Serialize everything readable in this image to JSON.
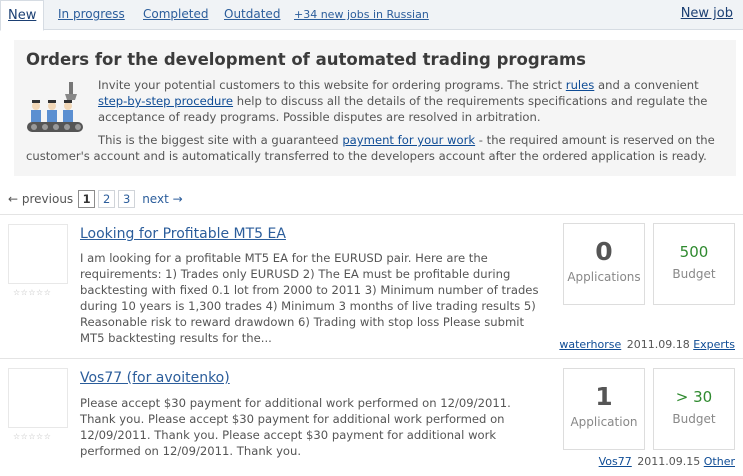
{
  "tabs": [
    {
      "label": "New"
    },
    {
      "label": "In progress"
    },
    {
      "label": "Completed"
    },
    {
      "label": "Outdated"
    },
    {
      "label": "+34 new jobs in Russian"
    }
  ],
  "new_job_label": "New job",
  "intro": {
    "title": "Orders for the development of automated trading programs",
    "p1_a": "Invite your potential customers to this website for ordering programs. The strict ",
    "p1_rules": "rules",
    "p1_b": " and a convenient ",
    "p1_steps": "step-by-step procedure",
    "p1_c": " help to discuss all the details of the requirements specifications and regulate the acceptance of ready programs. Possible disputes are resolved in arbitration.",
    "p2_a": "This is the biggest site with a guaranteed ",
    "p2_link": "payment for your work",
    "p2_b": " - the required amount is reserved on the customer's account and is automatically transferred to the developers account after the ordered application is ready."
  },
  "pager": {
    "prev": "← previous",
    "pages": [
      "1",
      "2",
      "3"
    ],
    "current": "1",
    "next": "next →"
  },
  "jobs": [
    {
      "stars": "☆☆☆☆☆",
      "title": "Looking for Profitable MT5 EA",
      "description": "I am looking for a profitable MT5 EA for the EURUSD pair. Here are the requirements: 1) Trades only EURUSD 2) The EA must be profitable during backtesting with fixed 0.1 lot from 2000 to 2011 3) Minimum number of trades during 10 years is 1,300 trades 4) Minimum 3 months of live trading results 5) Reasonable risk to reward drawdown 6) Trading with stop loss Please submit MT5 backtesting results for the...",
      "applications": "0",
      "applications_label": "Applications",
      "budget": "500",
      "budget_label": "Budget",
      "author": "waterhorse",
      "date": "2011.09.18",
      "category": "Experts"
    },
    {
      "stars": "☆☆☆☆☆",
      "title": "Vos77 (for avoitenko)",
      "description": "Please accept $30 payment for additional work performed on 12/09/2011. Thank you. Please accept $30 payment for additional work performed on 12/09/2011. Thank you. Please accept $30 payment for additional work performed on 12/09/2011. Thank you.",
      "applications": "1",
      "applications_label": "Application",
      "budget": "> 30",
      "budget_label": "Budget",
      "author": "Vos77",
      "date": "2011.09.15",
      "category": "Other"
    }
  ],
  "colors": {
    "link": "#2b5d9b",
    "budget": "#2f8a2f",
    "tab_bar": "#f0f3f6"
  }
}
